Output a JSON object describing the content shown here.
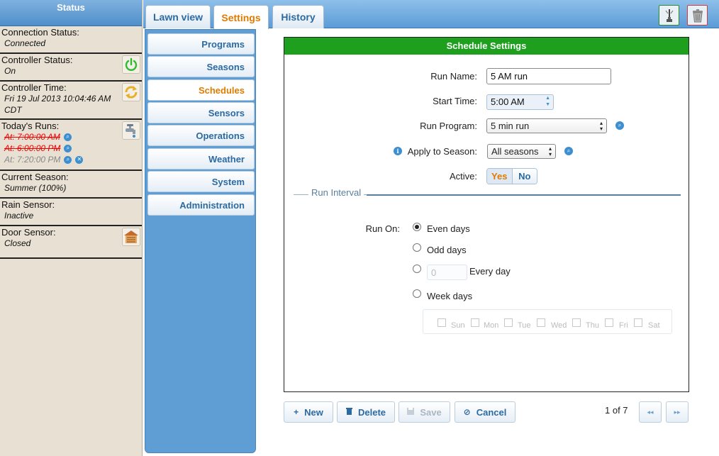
{
  "status": {
    "title": "Status",
    "connection": {
      "label": "Connection Status:",
      "value": "Connected"
    },
    "controller": {
      "label": "Controller Status:",
      "value": "On"
    },
    "time": {
      "label": "Controller Time:",
      "value": "Fri 19 Jul 2013 10:04:46 AM CDT"
    },
    "runs": {
      "label": "Today's Runs:",
      "items": [
        {
          "text": "At: 7:00:00 AM",
          "state": "done"
        },
        {
          "text": "At: 6:00:00 PM",
          "state": "done"
        },
        {
          "text": "At: 7:20:00 PM",
          "state": "pending"
        }
      ]
    },
    "season": {
      "label": "Current Season:",
      "value": "Summer (100%)"
    },
    "rain": {
      "label": "Rain Sensor:",
      "value": "Inactive"
    },
    "door": {
      "label": "Door Sensor:",
      "value": "Closed"
    }
  },
  "tabs": [
    {
      "label": "Lawn view",
      "active": false
    },
    {
      "label": "Settings",
      "active": true
    },
    {
      "label": "History",
      "active": false
    }
  ],
  "nav": [
    {
      "label": "Programs",
      "active": false
    },
    {
      "label": "Seasons",
      "active": false
    },
    {
      "label": "Schedules",
      "active": true
    },
    {
      "label": "Sensors",
      "active": false
    },
    {
      "label": "Operations",
      "active": false
    },
    {
      "label": "Weather",
      "active": false
    },
    {
      "label": "System",
      "active": false
    },
    {
      "label": "Administration",
      "active": false
    }
  ],
  "panel": {
    "title": "Schedule Settings",
    "run_name": {
      "label": "Run Name:",
      "value": "5 AM run"
    },
    "start_time": {
      "label": "Start Time:",
      "value": "5:00 AM"
    },
    "run_program": {
      "label": "Run Program:",
      "value": "5 min run"
    },
    "apply_season": {
      "label": "Apply to Season:",
      "value": "All seasons"
    },
    "active": {
      "label": "Active:",
      "yes": "Yes",
      "no": "No",
      "selected": "Yes"
    },
    "interval": {
      "legend": "Run Interval",
      "run_on_label": "Run On:",
      "options": {
        "even": "Even days",
        "odd": "Odd days",
        "every": "Every day",
        "week": "Week days"
      },
      "selected": "even",
      "every_value": "0",
      "days": [
        "Sun",
        "Mon",
        "Tue",
        "Wed",
        "Thu",
        "Fri",
        "Sat"
      ]
    }
  },
  "buttons": {
    "new": "New",
    "delete": "Delete",
    "save": "Save",
    "cancel": "Cancel"
  },
  "pagination": {
    "text": "1 of 7",
    "prev": "◂◂",
    "next": "▸▸"
  },
  "colors": {
    "header_green": "#1ea01e",
    "accent_orange": "#e07b00",
    "nav_blue": "#5e9ed4",
    "link_blue": "#2c6aa2"
  }
}
